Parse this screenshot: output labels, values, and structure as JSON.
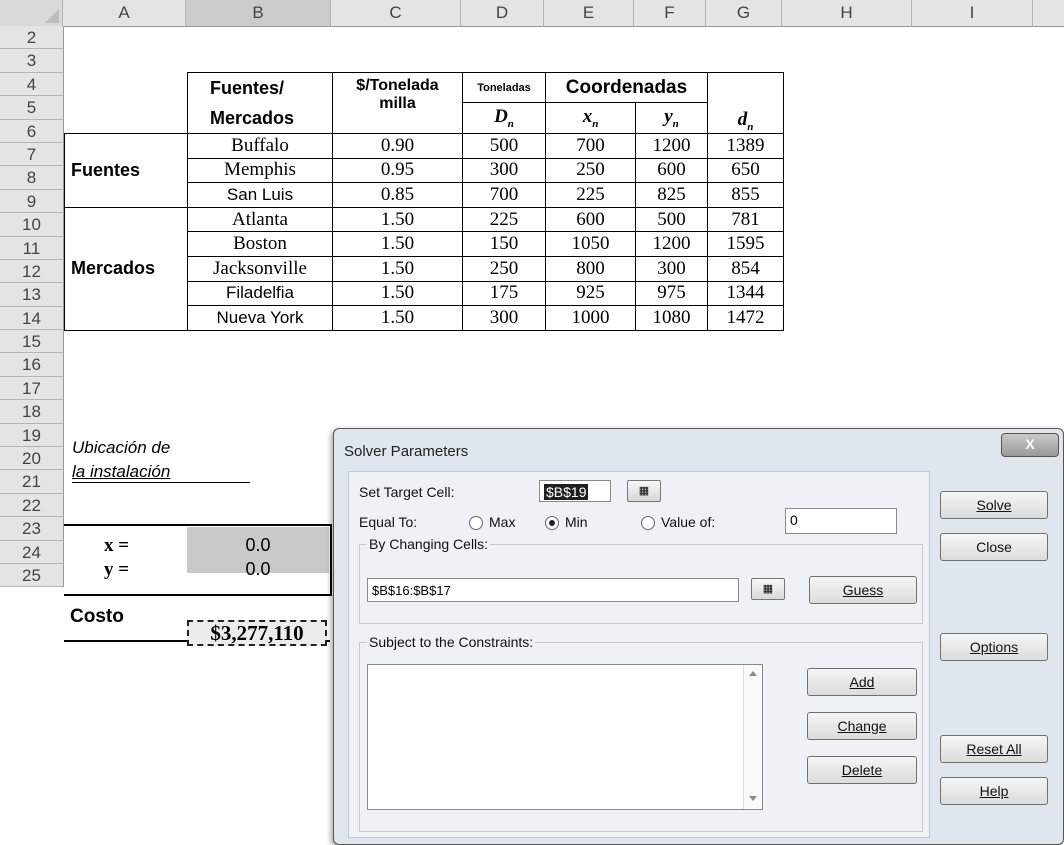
{
  "columns": [
    "A",
    "B",
    "C",
    "D",
    "E",
    "F",
    "G",
    "H",
    "I"
  ],
  "rows": [
    "2",
    "3",
    "4",
    "5",
    "6",
    "7",
    "8",
    "9",
    "10",
    "11",
    "12",
    "13",
    "14",
    "15",
    "16",
    "17",
    "18",
    "19",
    "20",
    "21",
    "22",
    "23",
    "24",
    "25"
  ],
  "table": {
    "header_sources_markets": "Fuentes/",
    "header_sources_markets_2": "Mercados",
    "header_cost": "$/Tonelada",
    "header_cost_2": "milla",
    "header_tons": "Toneladas",
    "header_tons_sym": "D",
    "header_coords": "Coordenadas",
    "header_x": "x",
    "header_y": "y",
    "header_d": "d",
    "sub_n": "n",
    "group_sources": "Fuentes",
    "group_markets": "Mercados",
    "rows": [
      {
        "name": "Buffalo",
        "rate": "0.90",
        "tons": "500",
        "x": "700",
        "y": "1200",
        "d": "1389"
      },
      {
        "name": "Memphis",
        "rate": "0.95",
        "tons": "300",
        "x": "250",
        "y": "600",
        "d": "650"
      },
      {
        "name": "San Luis",
        "rate": "0.85",
        "tons": "700",
        "x": "225",
        "y": "825",
        "d": "855"
      },
      {
        "name": "Atlanta",
        "rate": "1.50",
        "tons": "225",
        "x": "600",
        "y": "500",
        "d": "781"
      },
      {
        "name": "Boston",
        "rate": "1.50",
        "tons": "150",
        "x": "1050",
        "y": "1200",
        "d": "1595"
      },
      {
        "name": "Jacksonville",
        "rate": "1.50",
        "tons": "250",
        "x": "800",
        "y": "300",
        "d": "854"
      },
      {
        "name": "Filadelfia",
        "rate": "1.50",
        "tons": "175",
        "x": "925",
        "y": "975",
        "d": "1344"
      },
      {
        "name": "Nueva York",
        "rate": "1.50",
        "tons": "300",
        "x": "1000",
        "y": "1080",
        "d": "1472"
      }
    ]
  },
  "location": {
    "label_1": "Ubicación de",
    "label_2": "la instalación",
    "x_label": "x =",
    "x_value": "0.0",
    "y_label": "y =",
    "y_value": "0.0",
    "cost_label": "Costo",
    "cost_value": "$3,277,110"
  },
  "dialog": {
    "title": "Solver Parameters",
    "close_glyph": "X",
    "set_target_label": "Set Target Cell:",
    "target_value": "$B$19",
    "equal_to_label": "Equal To:",
    "max_label": "Max",
    "min_label": "Min",
    "value_of_label": "Value of:",
    "value_of_value": "0",
    "changing_label": "By Changing Cells:",
    "changing_value": "$B$16:$B$17",
    "constraints_label": "Subject to the Constraints:",
    "buttons": {
      "solve": "Solve",
      "close": "Close",
      "guess": "Guess",
      "options": "Options",
      "add": "Add",
      "change": "Change",
      "delete": "Delete",
      "reset_all": "Reset All",
      "help": "Help"
    }
  }
}
